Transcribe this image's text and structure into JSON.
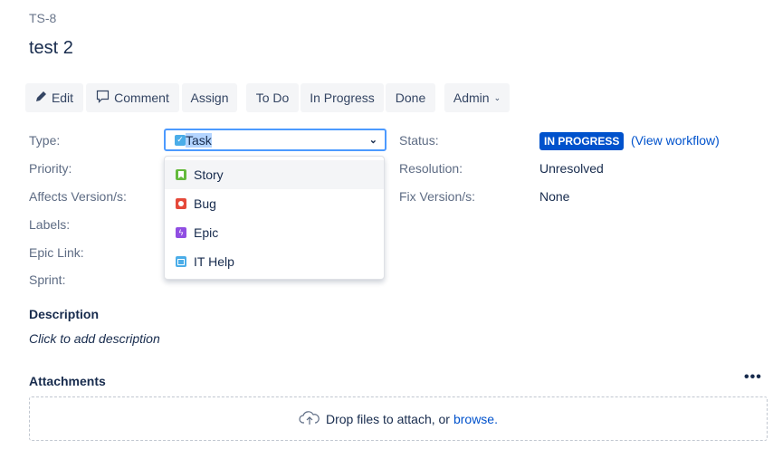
{
  "issue_key": "TS-8",
  "title": "test 2",
  "toolbar": {
    "edit": "Edit",
    "comment": "Comment",
    "assign": "Assign",
    "todo": "To Do",
    "inprogress": "In Progress",
    "done": "Done",
    "admin": "Admin"
  },
  "fields": {
    "type": "Type:",
    "priority": "Priority:",
    "affects": "Affects Version/s:",
    "labels": "Labels:",
    "epic_link": "Epic Link:",
    "sprint": "Sprint:",
    "status": "Status:",
    "resolution": "Resolution:",
    "fix": "Fix Version/s:"
  },
  "values": {
    "type": "Task",
    "status": "IN PROGRESS",
    "view_workflow": "(View workflow)",
    "resolution": "Unresolved",
    "fix": "None"
  },
  "type_options": [
    {
      "label": "Story",
      "color": "#63ba3c"
    },
    {
      "label": "Bug",
      "color": "#e5493a"
    },
    {
      "label": "Epic",
      "color": "#904ee2"
    },
    {
      "label": "IT Help",
      "color": "#4bade8"
    }
  ],
  "description": {
    "heading": "Description",
    "placeholder": "Click to add description"
  },
  "attachments": {
    "heading": "Attachments",
    "drop_text": "Drop files to attach, or",
    "browse": "browse."
  },
  "colors": {
    "accent": "#0052cc",
    "status_badge": "#0052cc"
  }
}
